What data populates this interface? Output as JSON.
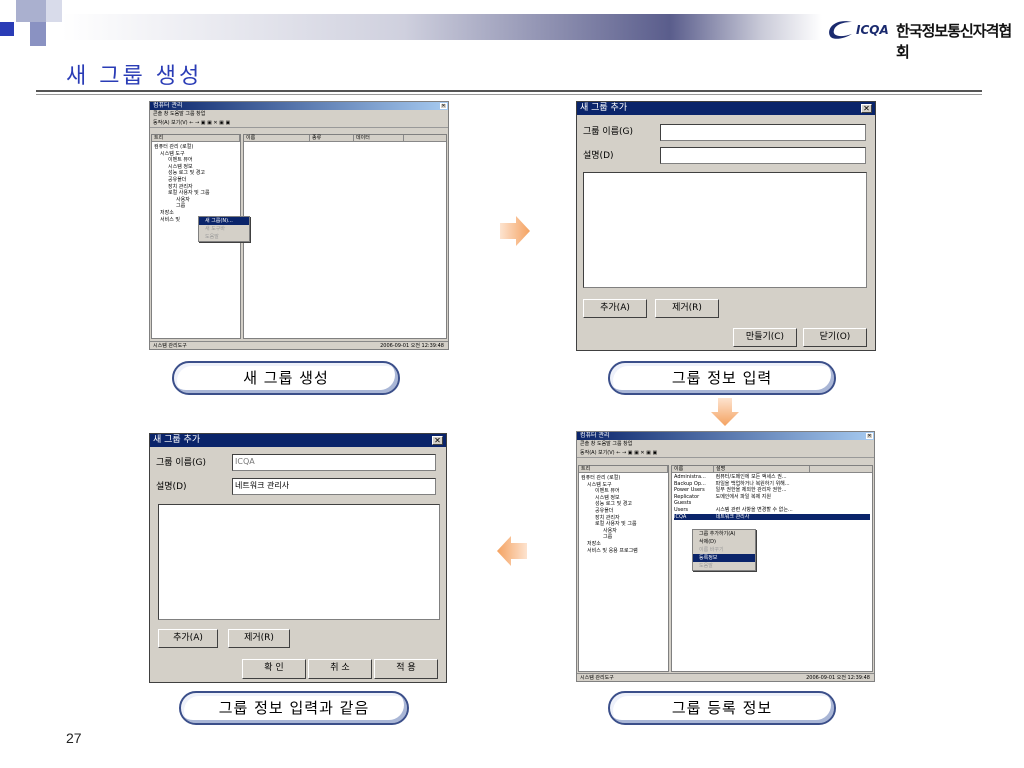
{
  "header": {
    "logo_text": "ICQA",
    "org_name": "한국정보통신자격협회",
    "title": "새 그룹 생성",
    "page_number": "27"
  },
  "colors": {
    "accent": "#2a3cb6",
    "titlebar": "#0a246a",
    "arrow": "#f4a261"
  },
  "panel1": {
    "title": "컴퓨터 관리",
    "menu": "콘솔  창  도움말  그룹 창업",
    "toolbar": "동작(A)  보기(V)   ← →  ▣ ▣  ✕ ▣  ▣",
    "tree_header": "트리",
    "columns": [
      "이름",
      "종류",
      "데이터"
    ],
    "tree": [
      "컴퓨터 관리 (로컬)",
      "시스템 도구",
      "이벤트 뷰어",
      "시스템 정보",
      "성능 로그 및 경고",
      "공유폴더",
      "장치 관리자",
      "로컬 사용자 및 그룹",
      "사용자",
      "그룹",
      "저장소",
      "서비스 및"
    ],
    "context_menu": [
      "새 그룹(N)...",
      "새 도구바",
      "도움말"
    ],
    "status_left": "시스템 관리도구",
    "status_right": "2006-09-01 오전 12:39:48"
  },
  "dialog1": {
    "title": "새 그룹 추가",
    "group_name_label": "그룹 이름(G)",
    "description_label": "설명(D)",
    "group_name_value": "",
    "description_value": "",
    "add_button": "추가(A)",
    "remove_button": "제거(R)",
    "create_button": "만들기(C)",
    "close_button": "닫기(O)"
  },
  "dialog2": {
    "title": "새 그룹 추가",
    "group_name_label": "그룹 이름(G)",
    "description_label": "설명(D)",
    "group_name_value": "ICQA",
    "description_value": "네트워크 관리사",
    "add_button": "추가(A)",
    "remove_button": "제거(R)",
    "ok_button": "확 인",
    "cancel_button": "취 소",
    "apply_button": "적 용"
  },
  "panel4": {
    "title": "컴퓨터 관리",
    "menu": "콘솔  창  도움말  그룹 창업",
    "toolbar": "동작(A)  보기(V)   ← →  ▣ ▣  ✕ ▣  ▣",
    "tree_header": "트리",
    "columns": [
      "이름",
      "설명"
    ],
    "tree": [
      "컴퓨터 관리 (로컬)",
      "시스템 도구",
      "이벤트 뷰어",
      "시스템 정보",
      "성능 로그 및 경고",
      "공유폴더",
      "장치 관리자",
      "로컬 사용자 및 그룹",
      "사용자",
      "그룹",
      "저장소",
      "서비스 및 응용 프로그램"
    ],
    "list": [
      {
        "name": "Administra...",
        "desc": "컴퓨터/도메인에 모든 액세스 권..."
      },
      {
        "name": "Backup Op...",
        "desc": "파일을 백업하거나 복원하기 위해..."
      },
      {
        "name": "Power Users",
        "desc": "일부 권한을 제외한 관리자 권한..."
      },
      {
        "name": "Replicator",
        "desc": "도메인에서 파일 복제 지원"
      },
      {
        "name": "Guests",
        "desc": ""
      },
      {
        "name": "Users",
        "desc": "시스템 관련 사항을 변경할 수 없는..."
      },
      {
        "name": "ICQA",
        "desc": "네트워크 관리사"
      }
    ],
    "context_menu": [
      "그룹 추가하기(A)",
      "삭제(D)",
      "이름 바꾸기",
      "등록정보",
      "도움말"
    ],
    "status_left": "시스템 관리도구",
    "status_right": "2006-09-01 오전 12:39:48"
  },
  "labels": {
    "step1": "새 그룹 생성",
    "step2": "그룹 정보 입력",
    "step3": "그룹 정보 입력과 같음",
    "step4": "그룹 등록 정보"
  }
}
